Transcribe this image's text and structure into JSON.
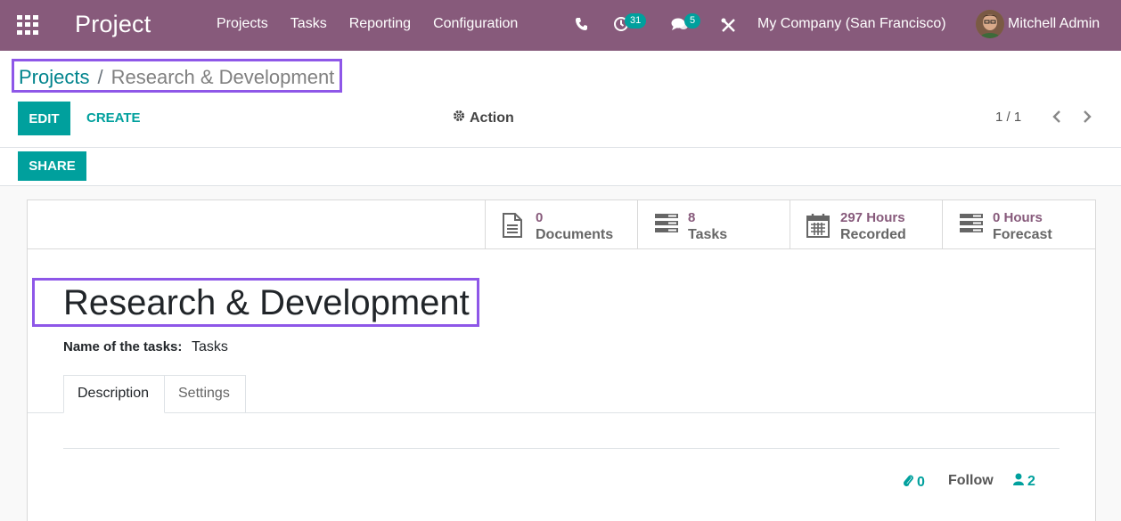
{
  "navbar": {
    "app_title": "Project",
    "menu": [
      "Projects",
      "Tasks",
      "Reporting",
      "Configuration"
    ],
    "activity_count": "31",
    "message_count": "5",
    "company": "My Company (San Francisco)",
    "user": "Mitchell Admin",
    "bg_color": "#875a7b"
  },
  "breadcrumb": {
    "parent": "Projects",
    "separator": "/",
    "current": "Research & Development"
  },
  "toolbar": {
    "edit_label": "EDIT",
    "create_label": "CREATE",
    "action_label": "Action",
    "pager": "1 / 1",
    "share_label": "SHARE"
  },
  "stat_buttons": [
    {
      "value": "0",
      "label": "Documents",
      "icon": "document-icon"
    },
    {
      "value": "8",
      "label": "Tasks",
      "icon": "tasks-icon"
    },
    {
      "value": "297 Hours",
      "label": "Recorded",
      "icon": "calendar-icon"
    },
    {
      "value": "0 Hours",
      "label": "Forecast",
      "icon": "forecast-icon"
    }
  ],
  "form": {
    "title": "Research & Development",
    "tasks_name_label": "Name of the tasks:",
    "tasks_name_value": "Tasks",
    "tabs": [
      "Description",
      "Settings"
    ]
  },
  "chatter": {
    "attachments": "0",
    "follow_label": "Follow",
    "followers": "2"
  },
  "colors": {
    "accent": "#00a09d",
    "highlight_border": "#8e57e8",
    "link": "#01848d"
  }
}
